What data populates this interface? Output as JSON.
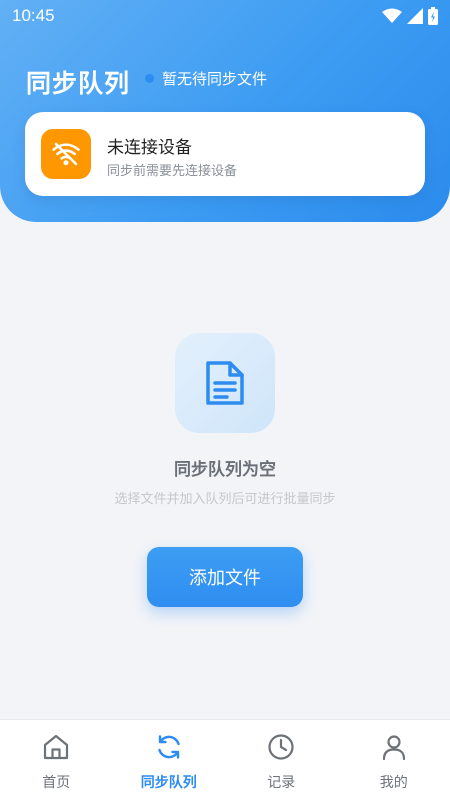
{
  "status_bar": {
    "time": "10:45"
  },
  "header": {
    "title": "同步队列",
    "status_text": "暂无待同步文件"
  },
  "device_card": {
    "title": "未连接设备",
    "subtitle": "同步前需要先连接设备",
    "icon": "wifi-off-icon"
  },
  "empty_state": {
    "icon": "document-icon",
    "title": "同步队列为空",
    "subtitle": "选择文件并加入队列后可进行批量同步",
    "button_label": "添加文件"
  },
  "tabbar": {
    "items": [
      {
        "label": "首页",
        "icon": "home-icon"
      },
      {
        "label": "同步队列",
        "icon": "sync-icon",
        "active": true
      },
      {
        "label": "记录",
        "icon": "clock-icon"
      },
      {
        "label": "我的",
        "icon": "user-icon"
      }
    ]
  },
  "colors": {
    "accent": "#2d8cf0",
    "warning": "#ff9800",
    "header_gradient_start": "#62b0f5",
    "header_gradient_end": "#2b8bec"
  }
}
